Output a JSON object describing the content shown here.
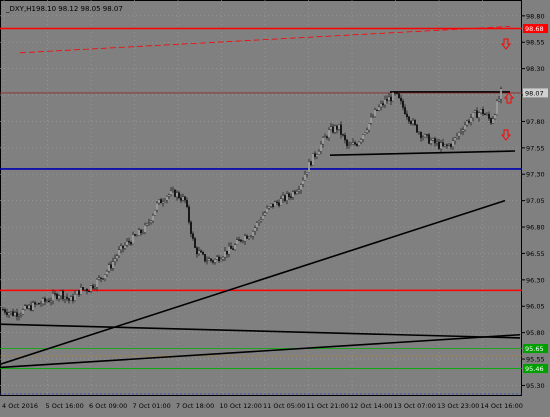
{
  "header": {
    "symbol": "_DXY,H1",
    "ohlc": "98.10 98.12 98.05 98.07"
  },
  "colors": {
    "background": "#808080",
    "grid": "#a0a0a0",
    "axis_text": "#000000",
    "bull_candle": "#f0f0f0",
    "bear_candle": "#101010",
    "red_level": "#ff0000",
    "blue_level": "#0000b0",
    "green_level": "#00b000",
    "trend_line": "#000000",
    "price_label_red": "#ff0000",
    "price_label_green": "#00a000",
    "price_label_gray": "#d0d0d0"
  },
  "price_labels": [
    {
      "value": "98.68",
      "kind": "red"
    },
    {
      "value": "98.07",
      "kind": "gray"
    },
    {
      "value": "95.65",
      "kind": "green"
    },
    {
      "value": "95.46",
      "kind": "green"
    }
  ],
  "chart_data": {
    "type": "candlestick",
    "y_axis": {
      "ticks": [
        "98.80",
        "98.55",
        "98.30",
        "98.05",
        "97.80",
        "97.55",
        "97.30",
        "97.05",
        "96.80",
        "96.55",
        "96.30",
        "96.05",
        "95.80",
        "95.55",
        "95.30"
      ],
      "ylim": [
        95.2,
        98.95
      ]
    },
    "x_axis": {
      "labels": [
        "4 Oct 2016",
        "5 Oct 16:00",
        "6 Oct 09:00",
        "7 Oct 01:00",
        "7 Oct 18:00",
        "10 Oct 12:00",
        "11 Oct 05:00",
        "11 Oct 21:00",
        "12 Oct 14:00",
        "13 Oct 07:00",
        "13 Oct 23:00",
        "14 Oct 16:00"
      ]
    },
    "close_path": [
      96.02,
      95.98,
      96.0,
      96.05,
      96.08,
      96.12,
      96.18,
      96.1,
      96.2,
      96.22,
      96.3,
      96.4,
      96.55,
      96.65,
      96.72,
      96.8,
      97.0,
      97.1,
      97.12,
      97.05,
      96.6,
      96.5,
      96.48,
      96.55,
      96.6,
      96.7,
      96.75,
      96.9,
      97.0,
      97.05,
      97.1,
      97.2,
      97.4,
      97.55,
      97.7,
      97.75,
      97.55,
      97.6,
      97.75,
      97.9,
      98.0,
      98.05,
      97.9,
      97.75,
      97.65,
      97.6,
      97.55,
      97.6,
      97.75,
      97.85,
      97.9,
      97.8,
      98.07
    ],
    "levels": [
      {
        "price": 98.68,
        "color": "red"
      },
      {
        "price": 98.07,
        "color": "brown"
      },
      {
        "price": 97.35,
        "color": "blue"
      },
      {
        "price": 96.2,
        "color": "red"
      },
      {
        "price": 95.65,
        "color": "green"
      },
      {
        "price": 95.46,
        "color": "green"
      }
    ]
  }
}
